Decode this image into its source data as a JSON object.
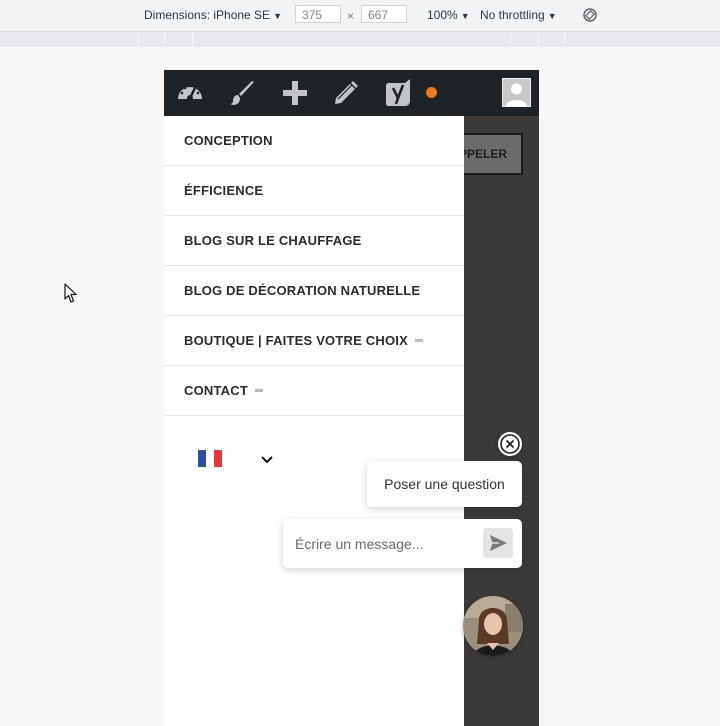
{
  "devtools": {
    "device_label": "Dimensions: iPhone SE",
    "width": "375",
    "height": "667",
    "times": "×",
    "zoom": "100%",
    "throttling": "No throttling"
  },
  "admin_bar": {
    "icons": [
      "dashboard-icon",
      "brush-icon",
      "plus-icon",
      "pencil-icon",
      "yoast-icon"
    ],
    "notification_color": "#f07a1a"
  },
  "header": {
    "call_button": "PPELER"
  },
  "menu": {
    "items": [
      {
        "label": "CONCEPTION",
        "has_submenu": false
      },
      {
        "label": "ÉFFICIENCE",
        "has_submenu": false
      },
      {
        "label": "BLOG SUR LE CHAUFFAGE",
        "has_submenu": false
      },
      {
        "label": "BLOG DE DÉCORATION NATURELLE",
        "has_submenu": false
      },
      {
        "label": "BOUTIQUE | FAITES VOTRE CHOIX",
        "has_submenu": true
      },
      {
        "label": "CONTACT",
        "has_submenu": true
      }
    ],
    "language": {
      "flag": "fr-flag-icon",
      "colors": [
        "#2f4fa3",
        "#ffffff",
        "#e8343a"
      ]
    }
  },
  "chat": {
    "question_prompt": "Poser une question",
    "input_placeholder": "Écrire un message..."
  }
}
